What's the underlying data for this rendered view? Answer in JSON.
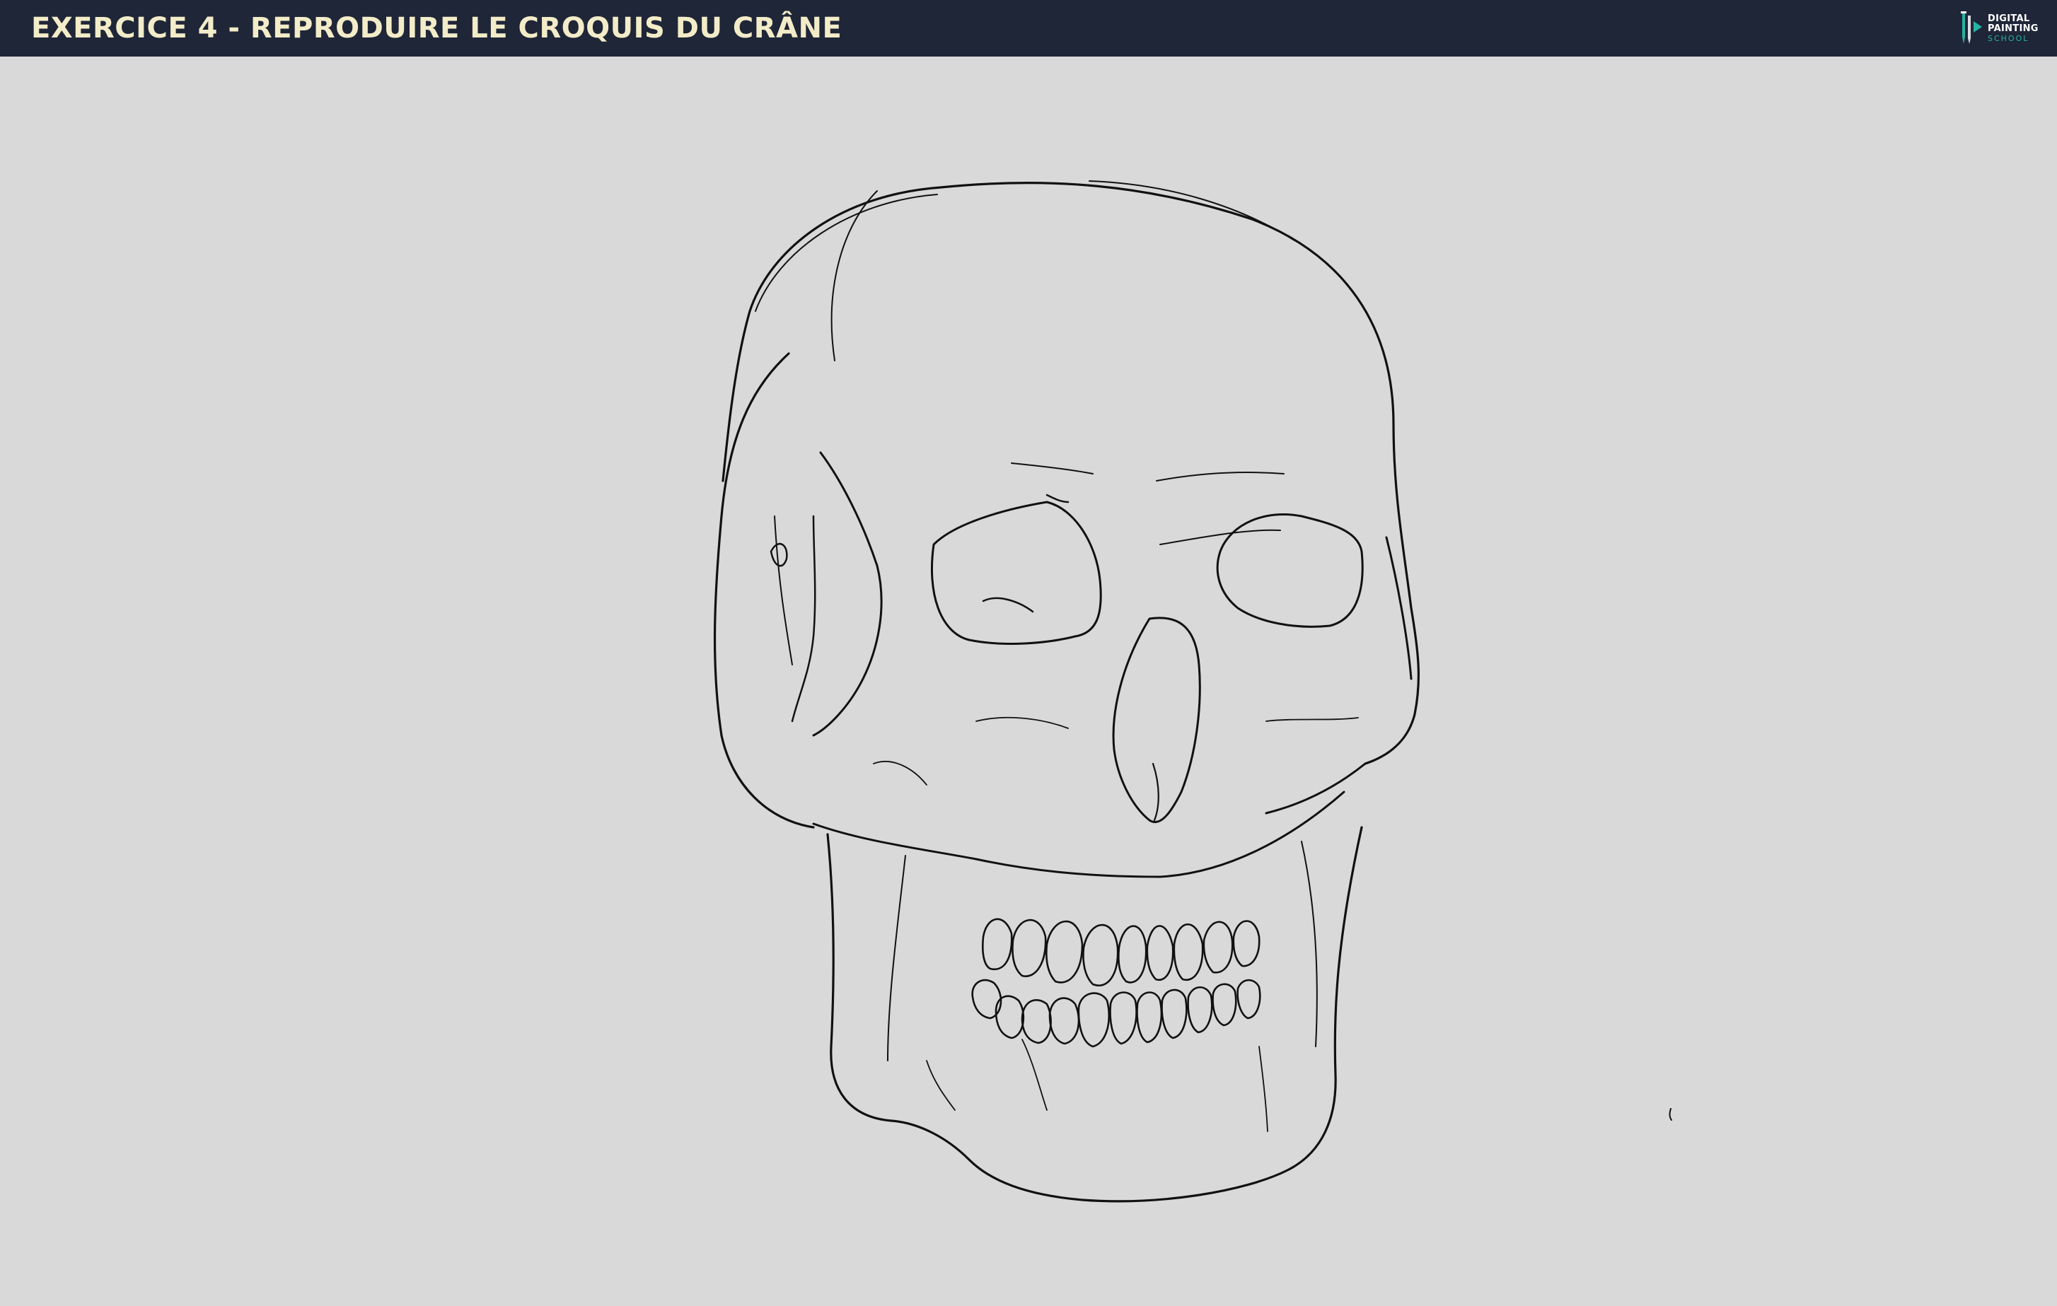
{
  "header": {
    "title": "EXERCICE 4 - REPRODUIRE LE CROQUIS DU CRÂNE",
    "logo": {
      "line1": "DIGITAL",
      "line2": "PAINTING",
      "line3": "SCHOOL",
      "icon": "paintbrush-logo-icon"
    }
  },
  "colors": {
    "header_bg": "#1f2638",
    "title_text": "#f3ecc8",
    "canvas_bg": "#d9d9d9",
    "ink": "#111111",
    "logo_accent": "#26b3a3"
  }
}
